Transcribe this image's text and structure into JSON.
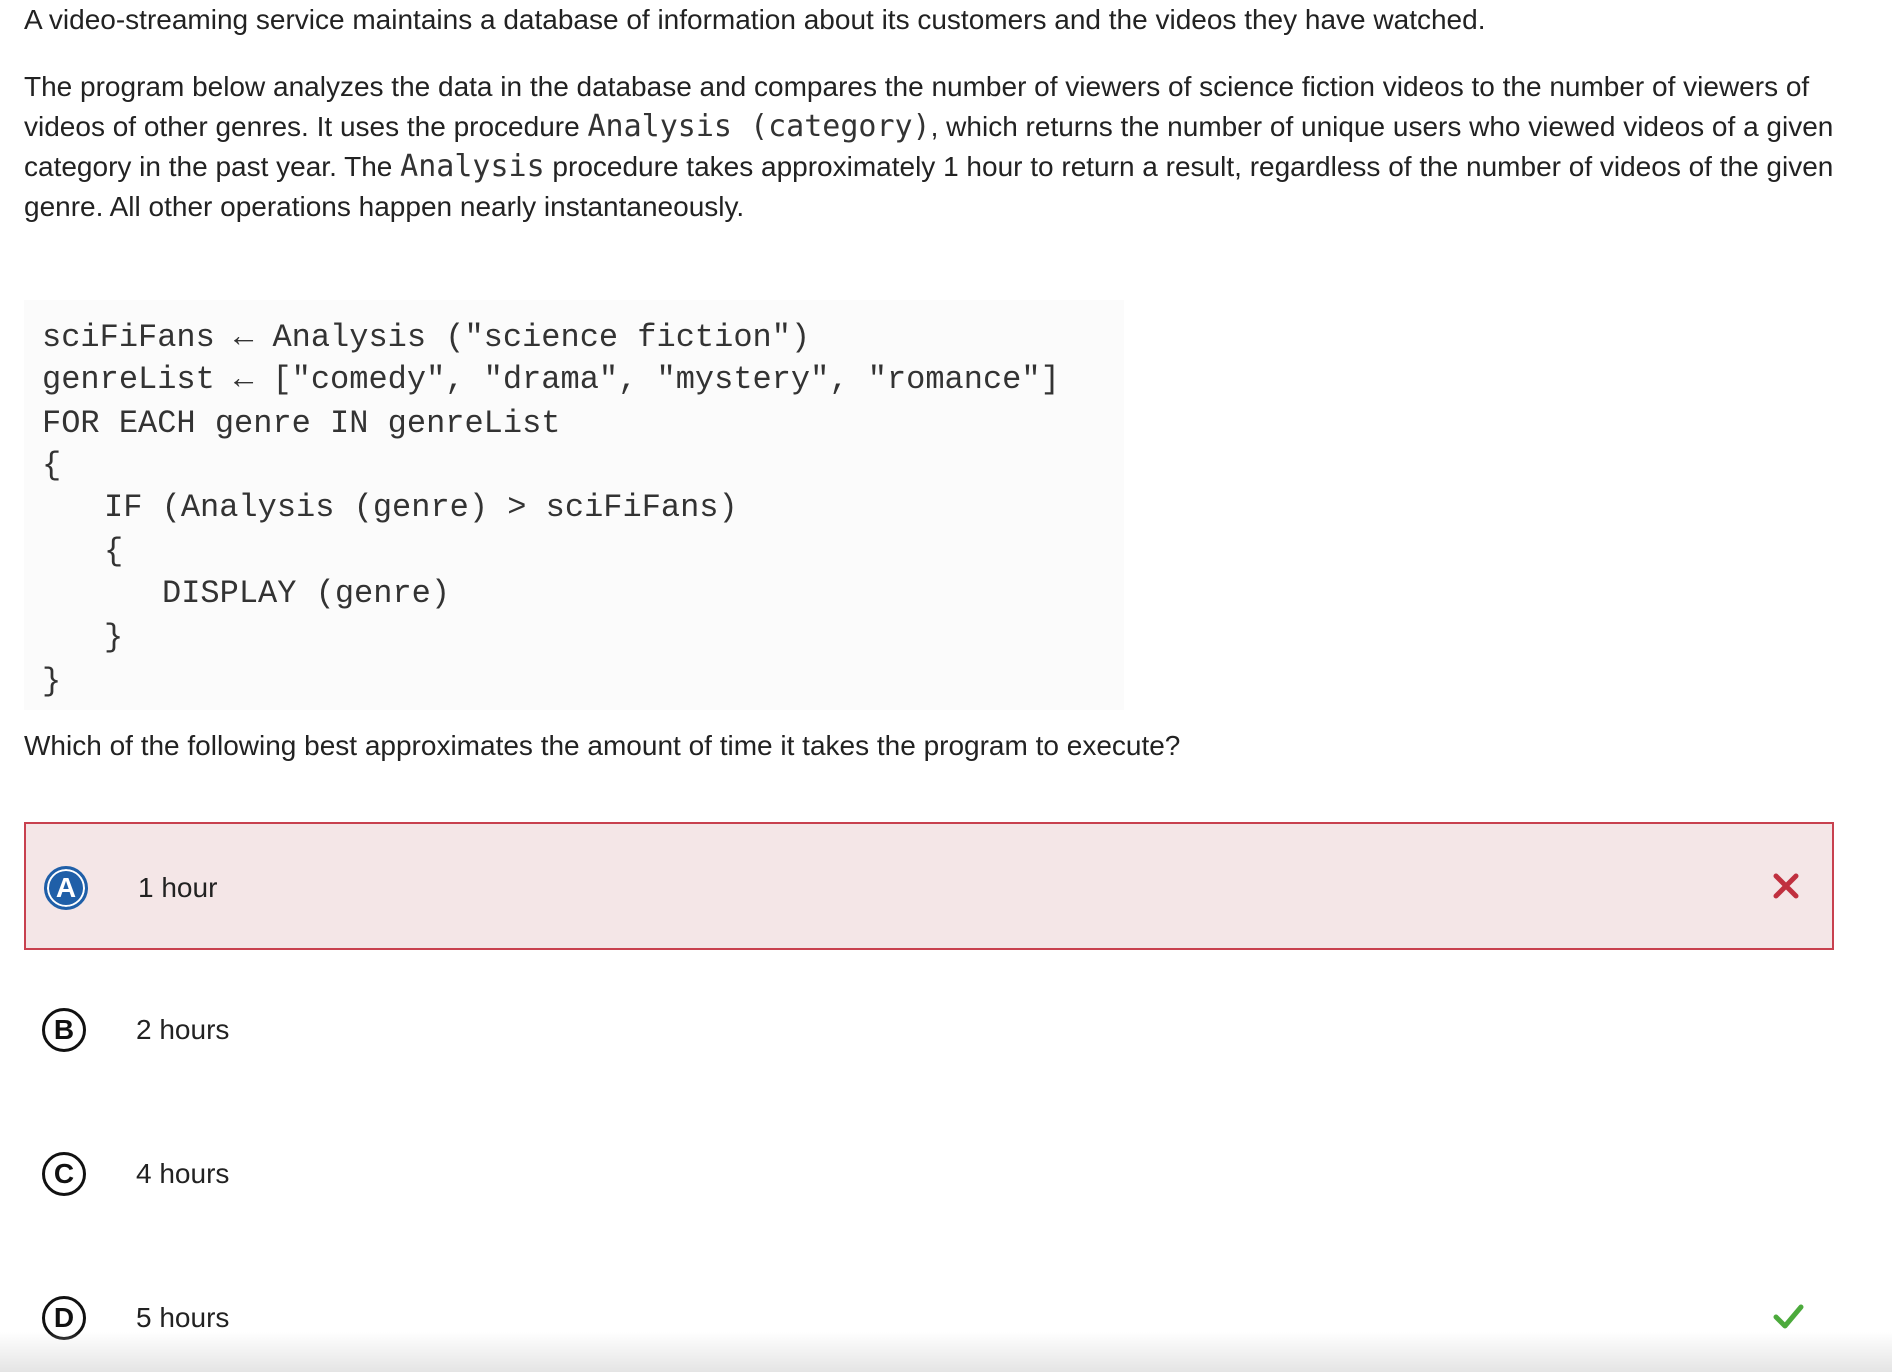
{
  "intro": {
    "sentence1": "A video-streaming service maintains a database of information about its customers and the videos they have watched.",
    "p2_part1": "The program below analyzes the data in the database and compares the number of viewers of science fiction videos to the number of viewers of videos of other genres. It uses the procedure ",
    "p2_code1": "Analysis (category)",
    "p2_part2": ", which returns the number of unique users who viewed videos of a given category in the past year. The ",
    "p2_code2": "Analysis",
    "p2_part3": " procedure takes approximately 1 hour to return a result, regardless of the number of videos of the given genre. All other operations happen nearly instantaneously."
  },
  "code": {
    "lines": [
      "sciFiFans ← Analysis (\"science fiction\")",
      "genreList ← [\"comedy\", \"drama\", \"mystery\", \"romance\"]",
      "FOR EACH genre IN genreList",
      "{",
      "IF (Analysis (genre) > sciFiFans)",
      "{",
      "DISPLAY (genre)",
      "}",
      "}"
    ]
  },
  "question": {
    "text": "Which of the following best approximates the amount of time it takes the program to execute?"
  },
  "options": [
    {
      "letter": "A",
      "text": "1 hour",
      "state": "selected-incorrect",
      "mark_icon": "x-mark-icon"
    },
    {
      "letter": "B",
      "text": "2 hours",
      "state": "unselected"
    },
    {
      "letter": "C",
      "text": "4 hours",
      "state": "unselected"
    },
    {
      "letter": "D",
      "text": "5 hours",
      "state": "correct",
      "mark_icon": "check-mark-icon"
    }
  ],
  "colors": {
    "incorrect_border": "#c8414f",
    "incorrect_bg": "#f4e6e7",
    "incorrect_mark": "#c0303f",
    "correct_mark": "#4caa3c",
    "selected_badge": "#1f5fa8"
  }
}
